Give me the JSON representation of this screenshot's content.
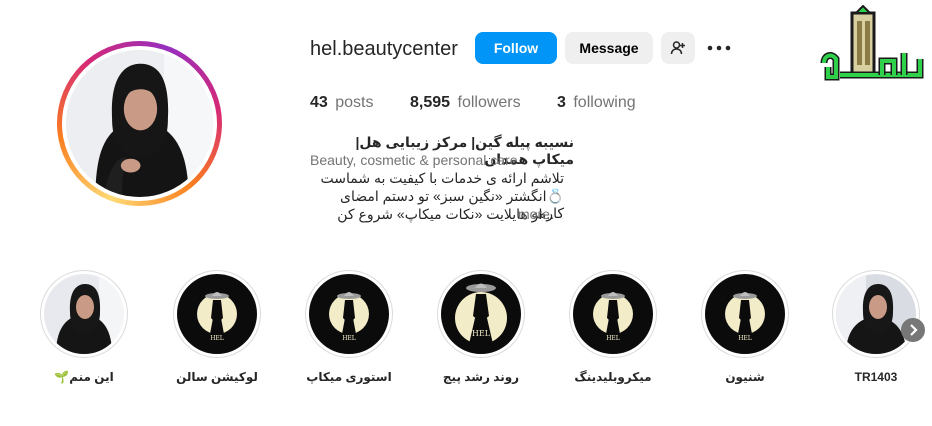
{
  "profile": {
    "username": "hel.beautycenter",
    "follow_label": "Follow",
    "message_label": "Message",
    "add_user_icon": "add-person-icon",
    "more_icon": "ellipsis-icon",
    "posts_count": "43",
    "posts_label": "posts",
    "followers_count": "8,595",
    "followers_label": "followers",
    "following_count": "3",
    "following_label": "following"
  },
  "bio": {
    "name": "نسیبه پیله گین| مرکز زیبایی هل| میکاپ همدان",
    "category": "Beauty, cosmetic & personal care",
    "line1": "تلاشم ارائه ی خدمات با کیفیت به شماست",
    "line2": "💍انگشتر «نگین سبز» تو دستم امضای کارمه",
    "line3": "...از هایلایت «نکات میکاپ» شروع کن",
    "more_label": "more"
  },
  "highlights": [
    {
      "label": "این منم🌱",
      "type": "photo"
    },
    {
      "label": "لوکیشن سالن",
      "type": "logo"
    },
    {
      "label": "استوری میکاپ",
      "type": "logo"
    },
    {
      "label": "روند رشد پیج",
      "type": "logo-dress"
    },
    {
      "label": "میکروبلیدینگ",
      "type": "logo"
    },
    {
      "label": "شنیون",
      "type": "logo"
    },
    {
      "label": "TR1403",
      "type": "photo"
    }
  ],
  "colors": {
    "follow_blue": "#0095f6",
    "button_gray": "#efefef",
    "muted_text": "#737373",
    "highlight_bg": "#0b0b0b",
    "highlight_moon": "#f3ecc8",
    "logo_green": "#2fd14b"
  }
}
